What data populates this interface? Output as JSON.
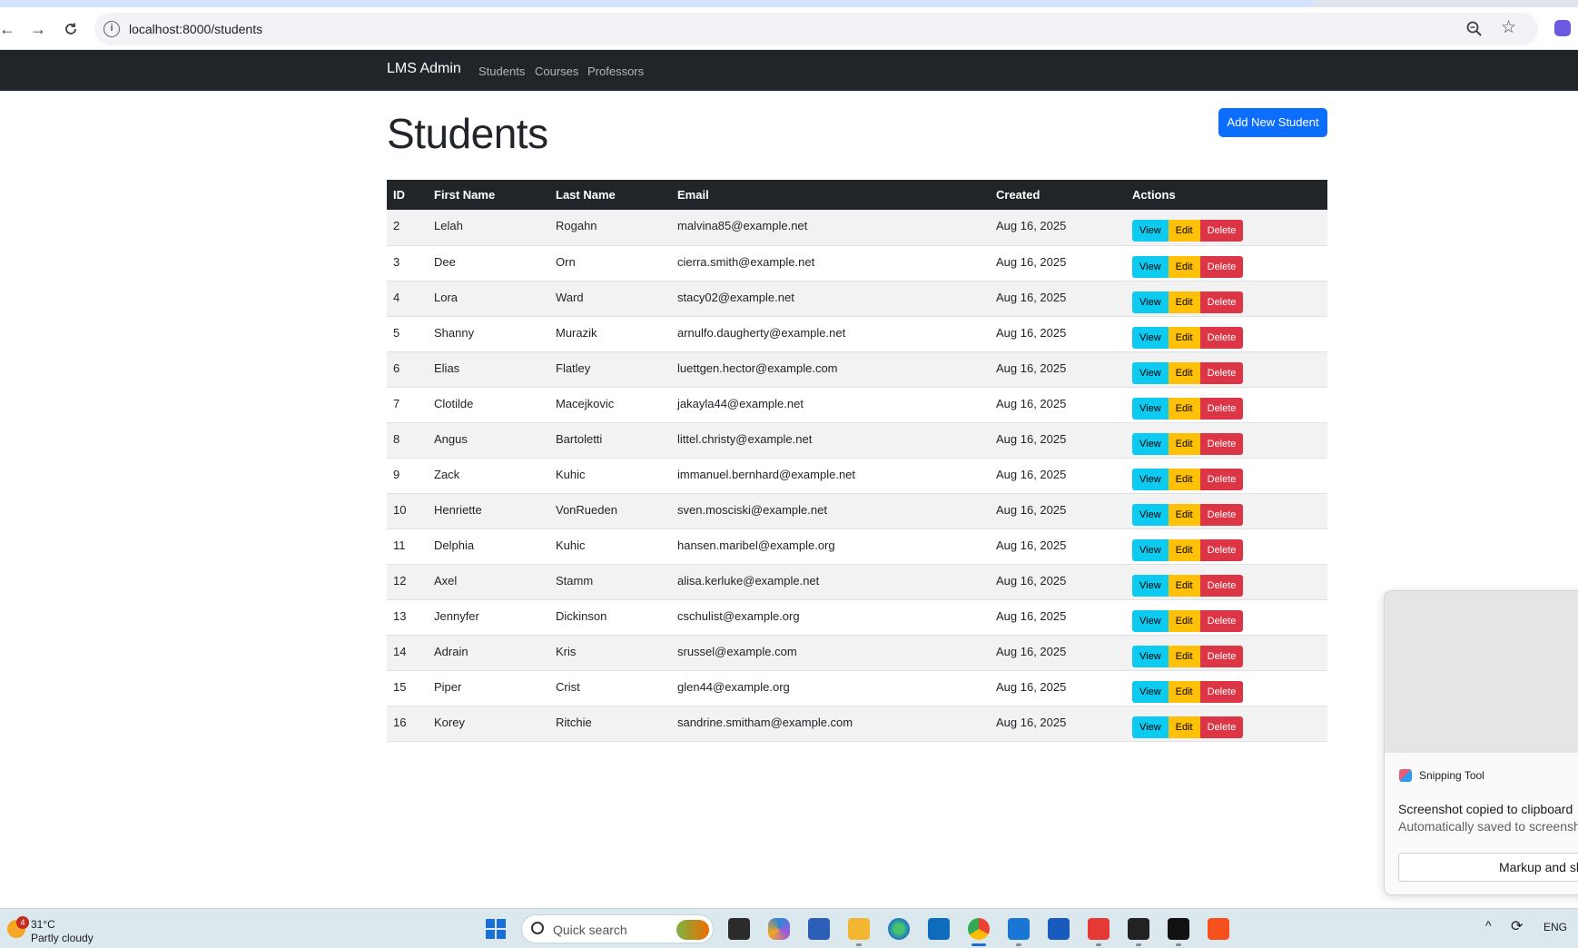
{
  "browser": {
    "url": "localhost:8000/students"
  },
  "navbar": {
    "brand": "LMS Admin",
    "links": [
      "Students",
      "Courses",
      "Professors"
    ]
  },
  "page": {
    "title": "Students",
    "add_button": "Add New Student"
  },
  "table": {
    "columns": [
      "ID",
      "First Name",
      "Last Name",
      "Email",
      "Created",
      "Actions"
    ],
    "action_labels": {
      "view": "View",
      "edit": "Edit",
      "delete": "Delete"
    },
    "rows": [
      {
        "id": "2",
        "first": "Lelah",
        "last": "Rogahn",
        "email": "malvina85@example.net",
        "created": "Aug 16, 2025"
      },
      {
        "id": "3",
        "first": "Dee",
        "last": "Orn",
        "email": "cierra.smith@example.net",
        "created": "Aug 16, 2025"
      },
      {
        "id": "4",
        "first": "Lora",
        "last": "Ward",
        "email": "stacy02@example.net",
        "created": "Aug 16, 2025"
      },
      {
        "id": "5",
        "first": "Shanny",
        "last": "Murazik",
        "email": "arnulfo.daugherty@example.net",
        "created": "Aug 16, 2025"
      },
      {
        "id": "6",
        "first": "Elias",
        "last": "Flatley",
        "email": "luettgen.hector@example.com",
        "created": "Aug 16, 2025"
      },
      {
        "id": "7",
        "first": "Clotilde",
        "last": "Macejkovic",
        "email": "jakayla44@example.net",
        "created": "Aug 16, 2025"
      },
      {
        "id": "8",
        "first": "Angus",
        "last": "Bartoletti",
        "email": "littel.christy@example.net",
        "created": "Aug 16, 2025"
      },
      {
        "id": "9",
        "first": "Zack",
        "last": "Kuhic",
        "email": "immanuel.bernhard@example.net",
        "created": "Aug 16, 2025"
      },
      {
        "id": "10",
        "first": "Henriette",
        "last": "VonRueden",
        "email": "sven.mosciski@example.net",
        "created": "Aug 16, 2025"
      },
      {
        "id": "11",
        "first": "Delphia",
        "last": "Kuhic",
        "email": "hansen.maribel@example.org",
        "created": "Aug 16, 2025"
      },
      {
        "id": "12",
        "first": "Axel",
        "last": "Stamm",
        "email": "alisa.kerluke@example.net",
        "created": "Aug 16, 2025"
      },
      {
        "id": "13",
        "first": "Jennyfer",
        "last": "Dickinson",
        "email": "cschulist@example.org",
        "created": "Aug 16, 2025"
      },
      {
        "id": "14",
        "first": "Adrain",
        "last": "Kris",
        "email": "srussel@example.com",
        "created": "Aug 16, 2025"
      },
      {
        "id": "15",
        "first": "Piper",
        "last": "Crist",
        "email": "glen44@example.org",
        "created": "Aug 16, 2025"
      },
      {
        "id": "16",
        "first": "Korey",
        "last": "Ritchie",
        "email": "sandrine.smitham@example.com",
        "created": "Aug 16, 2025"
      }
    ]
  },
  "notification": {
    "app_name": "Snipping Tool",
    "message": "Screenshot copied to clipboard",
    "sub_message": "Automatically saved to screensh",
    "button": "Markup and sh"
  },
  "taskbar": {
    "weather_badge": "4",
    "temperature": "31°C",
    "condition": "Partly cloudy",
    "search_placeholder": "Quick search",
    "language": "ENG"
  },
  "colors": {
    "navbar_bg": "#212529",
    "primary": "#0d6efd",
    "info": "#0dcaf0",
    "warning": "#ffc107",
    "danger": "#dc3545"
  }
}
